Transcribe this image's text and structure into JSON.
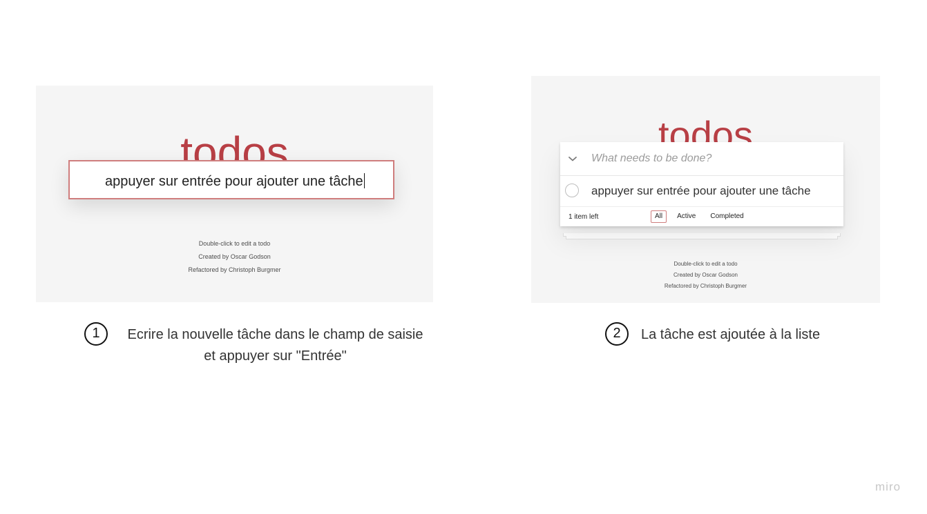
{
  "step1": {
    "screenshot": {
      "app_title": "todos",
      "input_value": "appuyer sur entrée pour ajouter une tâche",
      "info": [
        "Double-click to edit a todo",
        "Created by Oscar Godson",
        "Refactored by Christoph Burgmer"
      ]
    },
    "number": "1",
    "caption_line1": "Ecrire la nouvelle tâche dans le champ de saisie",
    "caption_line2": "et appuyer sur \"Entrée\""
  },
  "step2": {
    "screenshot": {
      "app_title": "todos",
      "input_placeholder": "What needs to be done?",
      "todos": [
        {
          "label": "appuyer sur entrée pour ajouter une tâche",
          "completed": false
        }
      ],
      "items_left": "1 item left",
      "filters": [
        "All",
        "Active",
        "Completed"
      ],
      "selected_filter": "All",
      "info": [
        "Double-click to edit a todo",
        "Created by Oscar Godson",
        "Refactored by Christoph Burgmer"
      ]
    },
    "number": "2",
    "caption": "La tâche est ajoutée à la liste"
  },
  "watermark": "miro",
  "colors": {
    "brand": "#b83f45",
    "panel_background": "#f5f5f5",
    "selected_border": "#cf7d7d"
  },
  "icons": {
    "toggle_all": "chevron-down-icon",
    "todo_toggle": "circle-checkbox-icon"
  }
}
